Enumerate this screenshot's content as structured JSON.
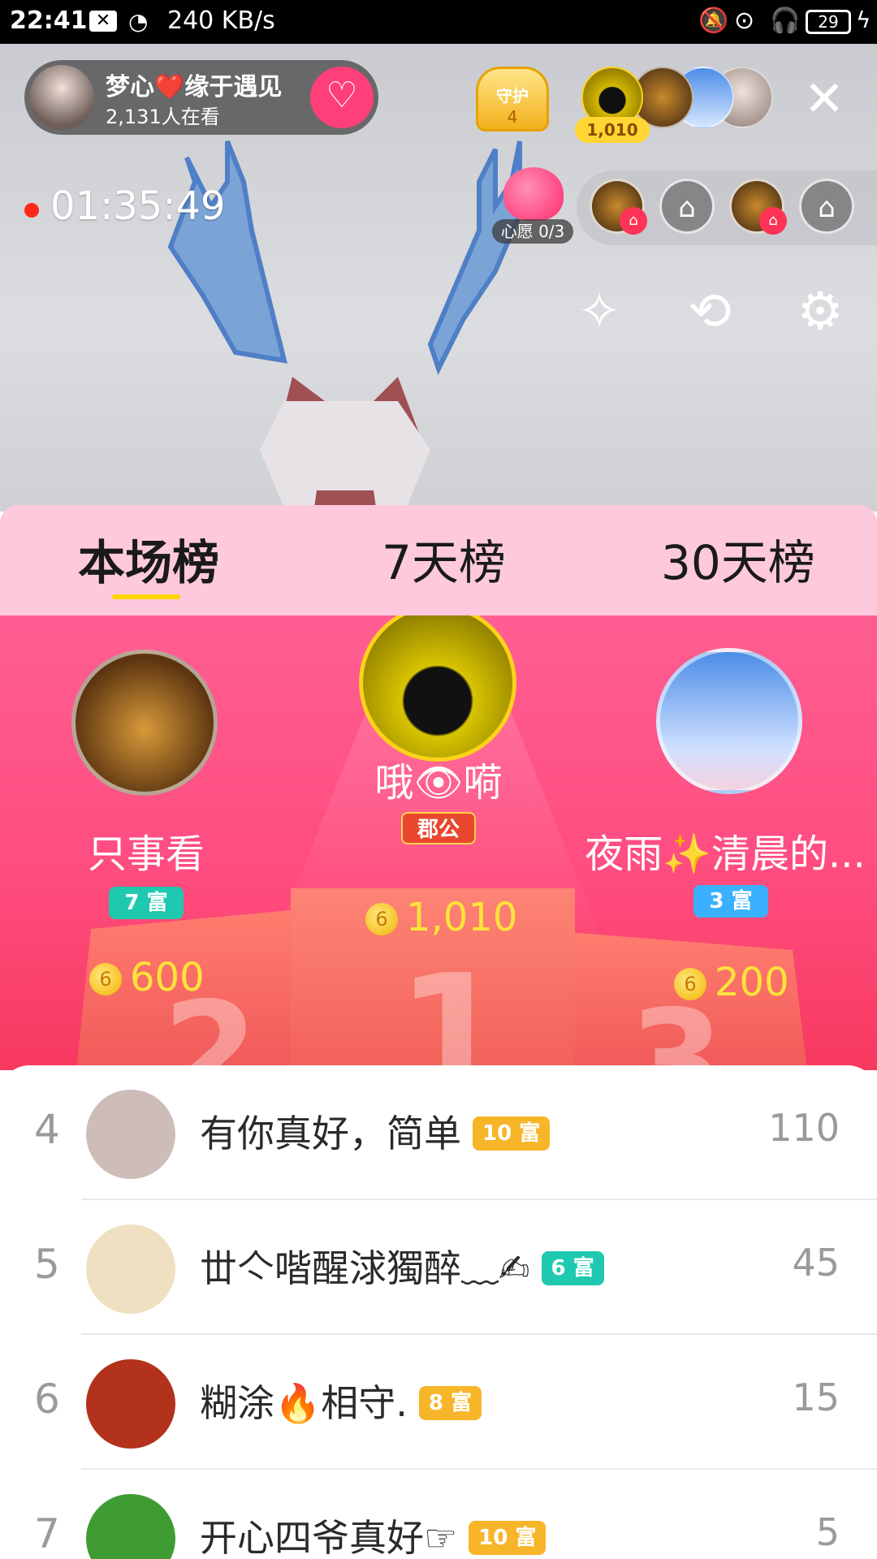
{
  "status_bar": {
    "time": "22:41",
    "notification_icon": "close-box-icon",
    "speed": "240 KB/s",
    "battery": "29",
    "icons": [
      "bell-off-icon",
      "lock-rotation-icon",
      "headphones-icon"
    ]
  },
  "header": {
    "host_name": "梦心❤️缘于遇见",
    "viewers": "2,131人在看",
    "guard_label": "守护",
    "guard_count": "4",
    "top_contrib_score": "1,010"
  },
  "live": {
    "timer": "01:35:49",
    "wish_label": "心愿 0/3"
  },
  "tabs": [
    {
      "label": "本场榜",
      "active": true
    },
    {
      "label": "7天榜",
      "active": false
    },
    {
      "label": "30天榜",
      "active": false
    }
  ],
  "podium": {
    "first": {
      "name": "哦👁嗬",
      "badge": "郡公",
      "score": "1,010"
    },
    "second": {
      "name": "只事看",
      "badge": "7 富",
      "score": "600"
    },
    "third": {
      "name": "夜雨✨清晨的...",
      "badge": "3 富",
      "score": "200"
    },
    "coin_glyph": "6"
  },
  "ranking": [
    {
      "rank": "4",
      "name": "有你真好，简单",
      "badge": "10 富",
      "badge_color": "#f7b52a",
      "score": "110",
      "avatar_color": "#cdbcb8"
    },
    {
      "rank": "5",
      "name": "丗亽喈醒浗獨醉﹏✍",
      "badge": "6 富",
      "badge_color": "#1ec9b0",
      "score": "45",
      "avatar_color": "#efe0c2"
    },
    {
      "rank": "6",
      "name": "糊涂🔥相守.",
      "badge": "8 富",
      "badge_color": "#f7b52a",
      "score": "15",
      "avatar_color": "#b2321c"
    },
    {
      "rank": "7",
      "name": "开心四爷真好☞",
      "badge": "10 富",
      "badge_color": "#f7b52a",
      "score": "5",
      "avatar_color": "#3f9c33"
    }
  ],
  "colors": {
    "accent_pink": "#ff4d80",
    "tab_bg": "#ffc9dd",
    "gold": "#ffe33a",
    "teal_badge": "#1ec9b0",
    "blue_badge": "#3bb0ff"
  }
}
